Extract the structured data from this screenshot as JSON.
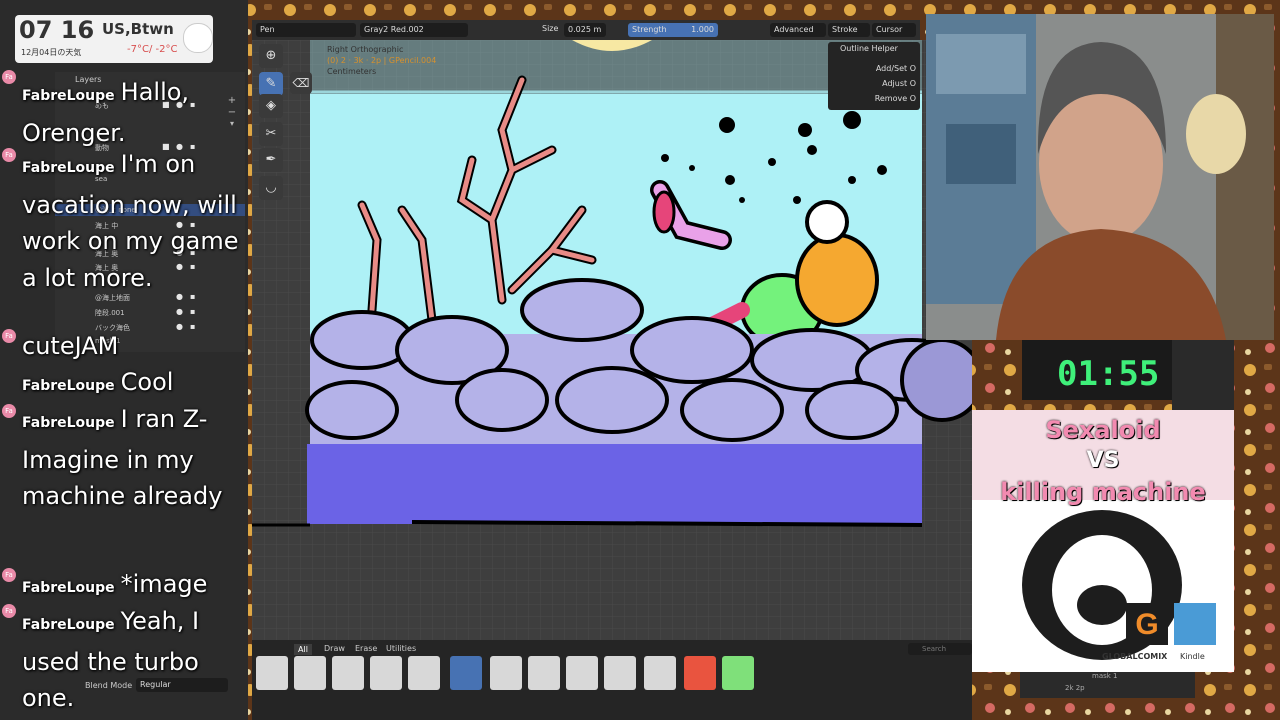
{
  "clock": {
    "time": "07 16",
    "location": "US,Btwn",
    "date_label": "12月04日の天気",
    "temps": "-7°C/ -2°C"
  },
  "chat": {
    "messages": [
      {
        "user": "FabreLoupe",
        "text": "Hallo, Orenger."
      },
      {
        "user": "FabreLoupe",
        "text": "I'm on vacation now, will work on my game a lot more."
      },
      {
        "user": "",
        "text": "cuteJAM"
      },
      {
        "user": "FabreLoupe",
        "text": "Cool"
      },
      {
        "user": "FabreLoupe",
        "text": "I ran Z-Imagine in my machine already"
      },
      {
        "user": "FabreLoupe",
        "text": "*image"
      },
      {
        "user": "FabreLoupe",
        "text": "Yeah, I used the turbo one."
      }
    ],
    "badge_label": "Fa"
  },
  "outliner": {
    "header": "Layers",
    "rows": [
      "めも",
      "動物",
      "sea",
      "@海上 none",
      "海上 中",
      "海上 奥",
      "海上 奥",
      "@海上地面",
      "陸段.001",
      "バック海色",
      "mask 1"
    ]
  },
  "toolbar": {
    "mode": "Pen",
    "material": "Gray2 Red.002",
    "size_label": "Size",
    "size_value": "0.025 m",
    "strength_label": "Strength",
    "strength_value": "1.000",
    "advanced": "Advanced",
    "stroke": "Stroke",
    "cursor": "Cursor"
  },
  "viewport_info": {
    "view": "Right Orthographic",
    "frame": "(0) 2 · 3k · 2p | GPencil.004",
    "units": "Centimeters"
  },
  "outline_helper": {
    "title": "Outline Helper",
    "items": [
      "Add/Set O",
      "Adjust O",
      "Remove O"
    ]
  },
  "brush_panel": {
    "tabs": [
      "All",
      "Draw",
      "Erase",
      "Utilities"
    ],
    "active_tab": "All",
    "search_placeholder": "Search",
    "blend_label": "Blend Mode",
    "blend_value": "Regular"
  },
  "timer": {
    "value": "01:55"
  },
  "cover": {
    "title_line1": "Sexaloid",
    "title_line2": "VS",
    "title_line3": "killing machine",
    "publisher": "GLOBALCOMIX",
    "kindle": "Kindle"
  },
  "status": {
    "layer_label": "mask 1",
    "frame": "2k 2p"
  },
  "colors": {
    "sky": "#aef1f6",
    "rocks": "#b4b2e8",
    "sea": "#6b63e6",
    "coral": "#e88b86",
    "timer_green": "#3ff07a",
    "accent_blue": "#4772b3"
  }
}
